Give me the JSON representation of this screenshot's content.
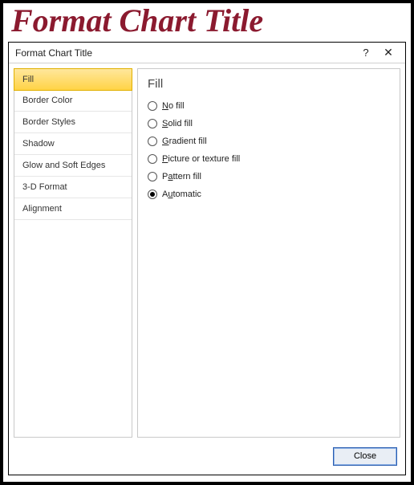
{
  "banner": "Format Chart Title",
  "dialog": {
    "title": "Format Chart Title",
    "help": "?",
    "close_glyph": "✕"
  },
  "sidebar": {
    "items": [
      {
        "label": "Fill",
        "selected": true
      },
      {
        "label": "Border Color",
        "selected": false
      },
      {
        "label": "Border Styles",
        "selected": false
      },
      {
        "label": "Shadow",
        "selected": false
      },
      {
        "label": "Glow and Soft Edges",
        "selected": false
      },
      {
        "label": "3-D Format",
        "selected": false
      },
      {
        "label": "Alignment",
        "selected": false
      }
    ]
  },
  "panel": {
    "title": "Fill",
    "options": [
      {
        "label": "No fill",
        "accel": "N",
        "checked": false
      },
      {
        "label": "Solid fill",
        "accel": "S",
        "checked": false
      },
      {
        "label": "Gradient fill",
        "accel": "G",
        "checked": false
      },
      {
        "label": "Picture or texture fill",
        "accel": "P",
        "checked": false
      },
      {
        "label": "Pattern fill",
        "accel": "A",
        "checked": false
      },
      {
        "label": "Automatic",
        "accel": "U",
        "checked": true
      }
    ]
  },
  "footer": {
    "close_label": "Close"
  }
}
